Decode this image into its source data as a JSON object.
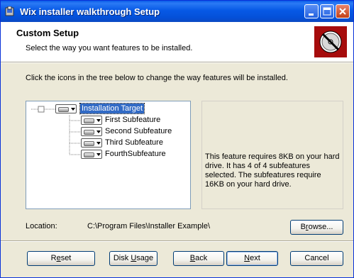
{
  "window": {
    "title": "Wix installer walkthrough Setup",
    "controls": {
      "minimize_icon": "minimize-icon",
      "maximize_icon": "maximize-icon",
      "close_icon": "close-icon"
    }
  },
  "banner": {
    "title": "Custom Setup",
    "subtitle": "Select the way you want features to be installed.",
    "icon": "no-cd-icon",
    "icon_color": "#a60c0c"
  },
  "instructions": "Click the icons in the tree below to change the way features will be installed.",
  "tree": {
    "root": {
      "label": "Installation Target",
      "expander": "⊟",
      "selected": true
    },
    "children": [
      {
        "label": "First Subfeature"
      },
      {
        "label": "Second Subfeature"
      },
      {
        "label": "Third Subfeature"
      },
      {
        "label": "FourthSubfeature"
      }
    ]
  },
  "description": "This feature requires 8KB on your hard drive. It has 4 of 4 subfeatures selected. The subfeatures require 16KB on your hard drive.",
  "location": {
    "label": "Location:",
    "value": "C:\\Program Files\\Installer Example\\",
    "browse": {
      "pre": "B",
      "acc": "r",
      "post": "owse..."
    }
  },
  "buttons": {
    "reset": {
      "pre": "R",
      "acc": "e",
      "post": "set"
    },
    "disk_usage": {
      "pre": "Disk ",
      "acc": "U",
      "post": "sage"
    },
    "back": {
      "pre": "",
      "acc": "B",
      "post": "ack"
    },
    "next": {
      "pre": "",
      "acc": "N",
      "post": "ext"
    },
    "cancel": {
      "pre": "Cancel",
      "acc": "",
      "post": ""
    }
  },
  "colors": {
    "titlebar": "#0a5ce8",
    "selection": "#316ac5",
    "dialog_bg": "#ece9d8"
  }
}
